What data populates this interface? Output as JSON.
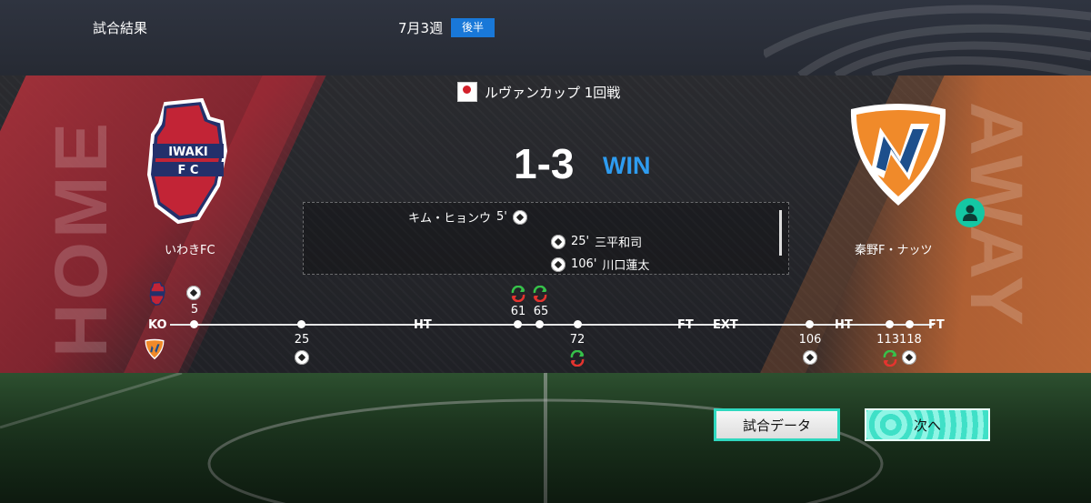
{
  "header": {
    "title": "試合結果",
    "date": "7月3週",
    "half_badge": "後半"
  },
  "competition": {
    "name": "ルヴァンカップ 1回戦"
  },
  "score": {
    "text": "1-3",
    "result": "WIN",
    "result_color": "#2e9cf0"
  },
  "home_team": {
    "name": "いわきFC",
    "side_label": "HOME",
    "crest_text_1": "IWAKI",
    "crest_text_2": "F C",
    "color": "#c22436"
  },
  "away_team": {
    "name": "秦野F・ナッツ",
    "side_label": "AWAY",
    "color": "#f08a2a"
  },
  "scorers": [
    {
      "team": "home",
      "minute": "5'",
      "name": "キム・ヒョンウ"
    },
    {
      "team": "away",
      "minute": "25'",
      "name": "三平和司"
    },
    {
      "team": "away",
      "minute": "106'",
      "name": "川口蓮太"
    }
  ],
  "timeline": {
    "labels": {
      "ko": "KO",
      "ht": "HT",
      "ft": "FT",
      "ext": "EXT",
      "ht2": "HT",
      "ft2": "FT"
    },
    "home_events": [
      {
        "minute": "5",
        "type": "goal"
      },
      {
        "minute": "61",
        "type": "substitution"
      },
      {
        "minute": "65",
        "type": "substitution"
      }
    ],
    "away_events": [
      {
        "minute": "25",
        "type": "goal"
      },
      {
        "minute": "72",
        "type": "substitution"
      },
      {
        "minute": "106",
        "type": "goal"
      },
      {
        "minute": "113",
        "type": "substitution"
      },
      {
        "minute": "118",
        "type": "goal"
      }
    ]
  },
  "buttons": {
    "match_data": "試合データ",
    "next": "次へ"
  }
}
